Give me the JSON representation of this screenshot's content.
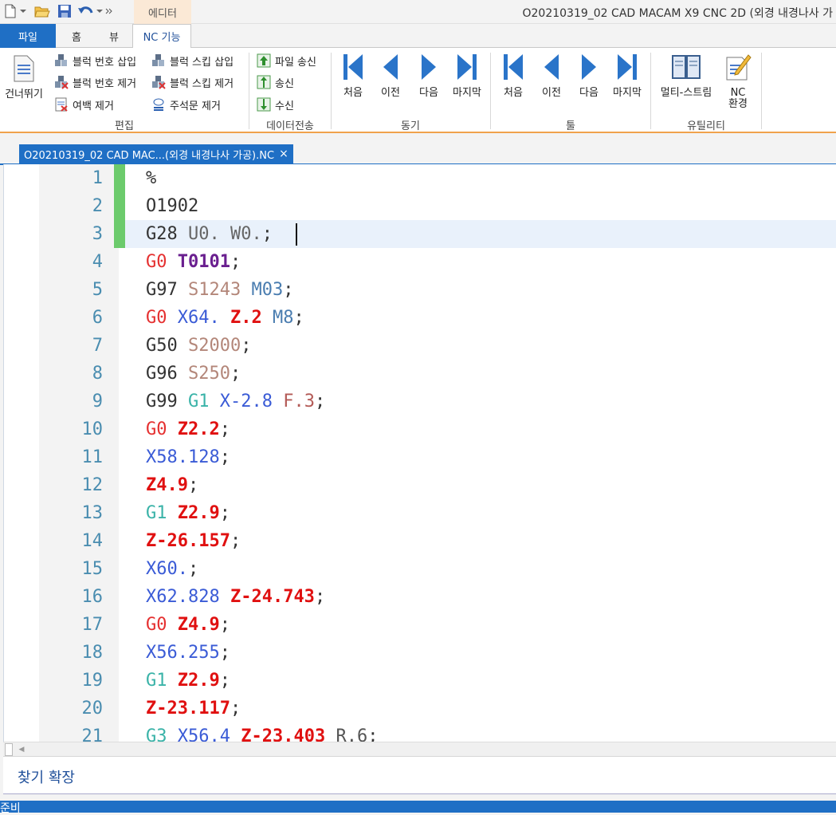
{
  "window": {
    "title": "O20210319_02 CAD MACAM X9 CNC 2D (외경 내경나사 가",
    "context_tab": "에디터"
  },
  "ribbon_tabs": {
    "file": "파일",
    "home": "홈",
    "view": "뷰",
    "nc": "NC 기능"
  },
  "ribbon": {
    "edit": {
      "label": "편집",
      "skip": "건너뛰기",
      "insert_block_number": "블럭 번호 삽입",
      "remove_block_number": "블럭 번호 제거",
      "remove_whitespace": "여백 제거",
      "insert_block_skip": "블럭 스킵 삽입",
      "remove_block_skip": "블럭 스킵 제거",
      "remove_comments": "주석문 제거"
    },
    "data_transfer": {
      "label": "데이터전송",
      "send_file": "파일 송신",
      "send": "송신",
      "receive": "수신"
    },
    "sync": {
      "label": "동기",
      "first": "처음",
      "prev": "이전",
      "next": "다음",
      "last": "마지막"
    },
    "tool": {
      "label": "툴",
      "first": "처음",
      "prev": "이전",
      "next": "다음",
      "last": "마지막"
    },
    "utility": {
      "label": "유틸리티",
      "multi_stream": "멀티-스트림",
      "nc_env_line1": "NC",
      "nc_env_line2": "환경"
    }
  },
  "document_tab": {
    "title": "O20210319_02 CAD MAC...(외경 내경나사 가공).NC",
    "close": "×"
  },
  "editor": {
    "lines": [
      {
        "n": "1",
        "tokens": [
          {
            "c": "t-plain",
            "t": "%"
          }
        ]
      },
      {
        "n": "2",
        "tokens": [
          {
            "c": "t-plain",
            "t": "O1902"
          }
        ]
      },
      {
        "n": "3",
        "tokens": [
          {
            "c": "t-plain",
            "t": "G28 "
          },
          {
            "c": "t-u",
            "t": "U0. W0."
          },
          {
            "c": "t-plain",
            "t": ";"
          }
        ]
      },
      {
        "n": "4",
        "tokens": [
          {
            "c": "t-gred",
            "t": "G0 "
          },
          {
            "c": "t-t",
            "t": "T0101"
          },
          {
            "c": "t-plain",
            "t": ";"
          }
        ]
      },
      {
        "n": "5",
        "tokens": [
          {
            "c": "t-plain",
            "t": "G97 "
          },
          {
            "c": "t-s",
            "t": "S1243 "
          },
          {
            "c": "t-m",
            "t": "M03"
          },
          {
            "c": "t-plain",
            "t": ";"
          }
        ]
      },
      {
        "n": "6",
        "tokens": [
          {
            "c": "t-gred",
            "t": "G0 "
          },
          {
            "c": "t-x",
            "t": "X64. "
          },
          {
            "c": "t-z",
            "t": "Z.2 "
          },
          {
            "c": "t-m",
            "t": "M8"
          },
          {
            "c": "t-plain",
            "t": ";"
          }
        ]
      },
      {
        "n": "7",
        "tokens": [
          {
            "c": "t-plain",
            "t": "G50 "
          },
          {
            "c": "t-s",
            "t": "S2000"
          },
          {
            "c": "t-plain",
            "t": ";"
          }
        ]
      },
      {
        "n": "8",
        "tokens": [
          {
            "c": "t-plain",
            "t": "G96 "
          },
          {
            "c": "t-s",
            "t": "S250"
          },
          {
            "c": "t-plain",
            "t": ";"
          }
        ]
      },
      {
        "n": "9",
        "tokens": [
          {
            "c": "t-plain",
            "t": "G99 "
          },
          {
            "c": "t-gteal",
            "t": "G1 "
          },
          {
            "c": "t-x",
            "t": "X-2.8 "
          },
          {
            "c": "t-f",
            "t": "F.3"
          },
          {
            "c": "t-plain",
            "t": ";"
          }
        ]
      },
      {
        "n": "10",
        "tokens": [
          {
            "c": "t-gred",
            "t": "G0 "
          },
          {
            "c": "t-z",
            "t": "Z2.2"
          },
          {
            "c": "t-plain",
            "t": ";"
          }
        ]
      },
      {
        "n": "11",
        "tokens": [
          {
            "c": "t-x",
            "t": "X58.128"
          },
          {
            "c": "t-plain",
            "t": ";"
          }
        ]
      },
      {
        "n": "12",
        "tokens": [
          {
            "c": "t-z",
            "t": "Z4.9"
          },
          {
            "c": "t-plain",
            "t": ";"
          }
        ]
      },
      {
        "n": "13",
        "tokens": [
          {
            "c": "t-gteal",
            "t": "G1 "
          },
          {
            "c": "t-z",
            "t": "Z2.9"
          },
          {
            "c": "t-plain",
            "t": ";"
          }
        ]
      },
      {
        "n": "14",
        "tokens": [
          {
            "c": "t-z",
            "t": "Z-26.157"
          },
          {
            "c": "t-plain",
            "t": ";"
          }
        ]
      },
      {
        "n": "15",
        "tokens": [
          {
            "c": "t-x",
            "t": "X60."
          },
          {
            "c": "t-plain",
            "t": ";"
          }
        ]
      },
      {
        "n": "16",
        "tokens": [
          {
            "c": "t-x",
            "t": "X62.828 "
          },
          {
            "c": "t-z",
            "t": "Z-24.743"
          },
          {
            "c": "t-plain",
            "t": ";"
          }
        ]
      },
      {
        "n": "17",
        "tokens": [
          {
            "c": "t-gred",
            "t": "G0 "
          },
          {
            "c": "t-z",
            "t": "Z4.9"
          },
          {
            "c": "t-plain",
            "t": ";"
          }
        ]
      },
      {
        "n": "18",
        "tokens": [
          {
            "c": "t-x",
            "t": "X56.255"
          },
          {
            "c": "t-plain",
            "t": ";"
          }
        ]
      },
      {
        "n": "19",
        "tokens": [
          {
            "c": "t-gteal",
            "t": "G1 "
          },
          {
            "c": "t-z",
            "t": "Z2.9"
          },
          {
            "c": "t-plain",
            "t": ";"
          }
        ]
      },
      {
        "n": "20",
        "tokens": [
          {
            "c": "t-z",
            "t": "Z-23.117"
          },
          {
            "c": "t-plain",
            "t": ";"
          }
        ]
      },
      {
        "n": "21",
        "tokens": [
          {
            "c": "t-gteal",
            "t": "G3 "
          },
          {
            "c": "t-x",
            "t": "X56.4 "
          },
          {
            "c": "t-z",
            "t": "Z-23.403 "
          },
          {
            "c": "t-r",
            "t": "R.6"
          },
          {
            "c": "t-plain",
            "t": ";"
          }
        ]
      }
    ]
  },
  "find_bar": {
    "label": "찾기 확장"
  },
  "status": {
    "text": "준비"
  }
}
